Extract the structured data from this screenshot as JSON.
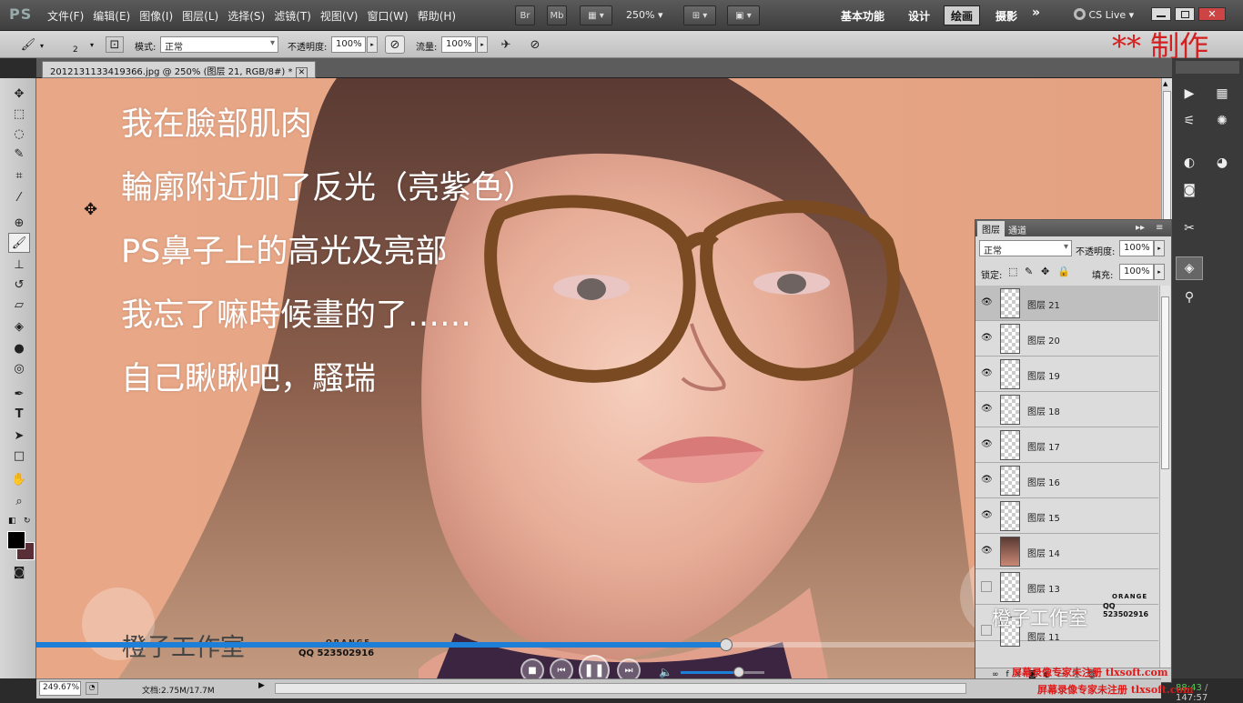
{
  "app": {
    "logo": "PS"
  },
  "menu": [
    "文件(F)",
    "编辑(E)",
    "图像(I)",
    "图层(L)",
    "选择(S)",
    "滤镜(T)",
    "视图(V)",
    "窗口(W)",
    "帮助(H)"
  ],
  "menubar": {
    "br": "Br",
    "mb": "Mb",
    "zoom": "250%",
    "workspaces": [
      "基本功能",
      "设计",
      "绘画",
      "摄影"
    ],
    "active_workspace": "绘画",
    "more": "»",
    "cslive": "CS Live"
  },
  "options": {
    "brush_size": "2",
    "mode_label": "模式:",
    "mode_value": "正常",
    "opacity_label": "不透明度:",
    "opacity_value": "100%",
    "flow_label": "流量:",
    "flow_value": "100%"
  },
  "watermark_top": "** 制作",
  "document": {
    "tab_title": "2012131133419366.jpg @ 250% (图层 21, RGB/8#) *"
  },
  "overlay_lines": [
    "我在臉部肌肉",
    "輪廓附近加了反光（亮紫色）",
    "PS鼻子上的高光及亮部",
    "我忘了嘛時候畫的了……",
    "自己瞅瞅吧，騷瑞"
  ],
  "studio": {
    "name": "橙子工作室",
    "brand": "ORANGE",
    "qq": "QQ 523502916"
  },
  "layers_panel": {
    "tabs": [
      "图层",
      "通道"
    ],
    "blend_mode": "正常",
    "opacity_label": "不透明度:",
    "opacity_value": "100%",
    "lock_label": "锁定:",
    "fill_label": "填充:",
    "fill_value": "100%",
    "layers": [
      {
        "name": "图层 21",
        "visible": true,
        "selected": true
      },
      {
        "name": "图层 20",
        "visible": true,
        "selected": false
      },
      {
        "name": "图层 19",
        "visible": true,
        "selected": false
      },
      {
        "name": "图层 18",
        "visible": true,
        "selected": false
      },
      {
        "name": "图层 17",
        "visible": true,
        "selected": false
      },
      {
        "name": "图层 16",
        "visible": true,
        "selected": false
      },
      {
        "name": "图层 15",
        "visible": true,
        "selected": false
      },
      {
        "name": "图层 14",
        "visible": true,
        "selected": false
      },
      {
        "name": "图层 13",
        "visible": false,
        "selected": false
      },
      {
        "name": "图层 11",
        "visible": false,
        "selected": false
      }
    ]
  },
  "player": {
    "elapsed": "88:43",
    "total": "147:57",
    "progress": 0.6,
    "volume": 0.7
  },
  "status": {
    "zoom": "249.67%",
    "doc": "文档:2.75M/17.7M"
  },
  "recorder_watermark": {
    "line1": "屏幕录像专家未注册 tlxsoft.com",
    "line2": "屏幕录像专家未注册 tlxsoft.com"
  },
  "colors": {
    "accent_red": "#d42020",
    "progress_blue": "#1e7fd8"
  }
}
